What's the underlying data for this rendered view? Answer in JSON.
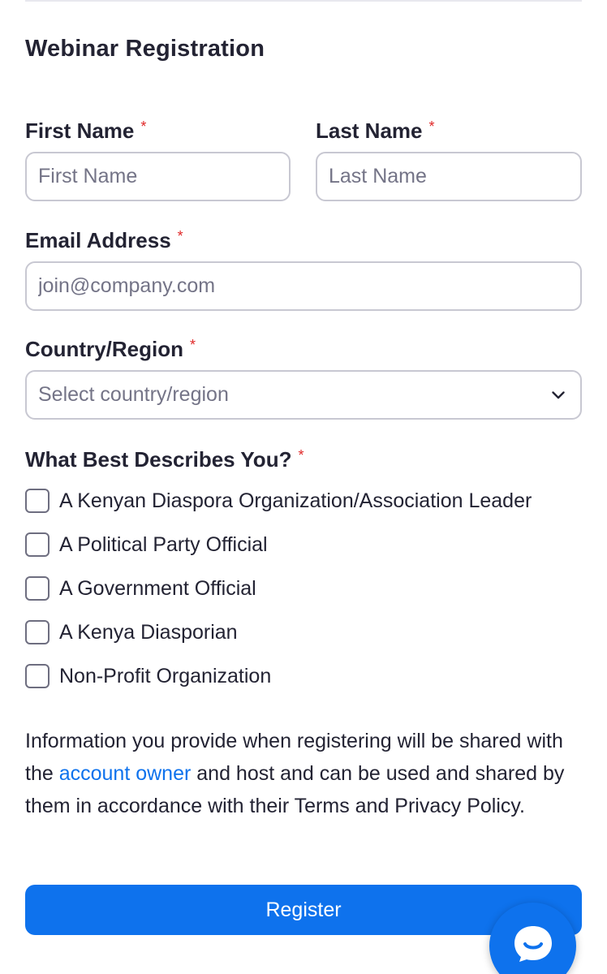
{
  "form": {
    "title": "Webinar Registration",
    "required_mark": "*"
  },
  "fields": {
    "first_name": {
      "label": "First Name",
      "placeholder": "First Name",
      "value": ""
    },
    "last_name": {
      "label": "Last Name",
      "placeholder": "Last Name",
      "value": ""
    },
    "email": {
      "label": "Email Address",
      "placeholder": "join@company.com",
      "value": ""
    },
    "country": {
      "label": "Country/Region",
      "selected": "Select country/region"
    }
  },
  "describe": {
    "label": "What Best Describes You?",
    "options": [
      {
        "label": "A Kenyan Diaspora Organization/Association Leader",
        "checked": false
      },
      {
        "label": "A Political Party Official",
        "checked": false
      },
      {
        "label": "A Government Official",
        "checked": false
      },
      {
        "label": "A Kenya Diasporian",
        "checked": false
      },
      {
        "label": "Non-Profit Organization",
        "checked": false
      }
    ]
  },
  "disclaimer": {
    "part1": "Information you provide when registering will be shared with the ",
    "link": "account owner",
    "part2": " and host and can be used and shared by them in accordance with their Terms and Privacy Policy."
  },
  "register_button": {
    "label": "Register"
  },
  "chat": {
    "icon": "chat-bubble-icon"
  },
  "colors": {
    "accent": "#0e72ed",
    "required": "#e02828",
    "text": "#232333",
    "placeholder": "#747487",
    "border": "#c8c8d2"
  }
}
